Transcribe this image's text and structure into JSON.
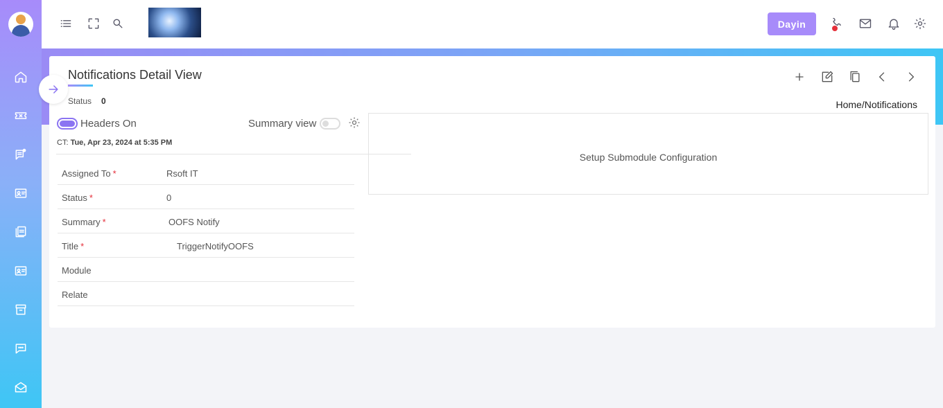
{
  "sidebar": {
    "items": [
      {
        "name": "home"
      },
      {
        "name": "ticket"
      },
      {
        "name": "notes"
      },
      {
        "name": "contact-card"
      },
      {
        "name": "pdf-docs"
      },
      {
        "name": "id-card"
      },
      {
        "name": "archive"
      },
      {
        "name": "chat"
      },
      {
        "name": "mail-open"
      }
    ]
  },
  "header": {
    "user_button": "Dayin",
    "icons": [
      "menu-icon",
      "fullscreen-icon",
      "search-icon",
      "phone-icon",
      "mail-icon",
      "bell-icon",
      "gear-icon"
    ],
    "status_dot_color": "#e5303b"
  },
  "page": {
    "title": "Notifications Detail View",
    "status_label": "Status",
    "status_value": "0",
    "breadcrumb": "Home/Notifications",
    "toolbar_icons": [
      "add-icon",
      "edit-icon",
      "copy-icon",
      "chevron-left-icon",
      "chevron-right-icon"
    ]
  },
  "panel": {
    "headers_toggle_label": "Headers On",
    "headers_toggle_on": true,
    "summary_toggle_label": "Summary view",
    "summary_toggle_on": false,
    "ct_prefix": "CT: ",
    "ct_value": "Tue, Apr 23, 2024 at 5:35 PM",
    "fields": [
      {
        "label": "Assigned To",
        "required": true,
        "value": "Rsoft IT"
      },
      {
        "label": "Status",
        "required": true,
        "value": "0"
      },
      {
        "label": "Summary",
        "required": true,
        "value": "OOFS Notify"
      },
      {
        "label": "Title",
        "required": true,
        "value": "TriggerNotifyOOFS"
      },
      {
        "label": "Module",
        "required": false,
        "value": ""
      },
      {
        "label": "Relate",
        "required": false,
        "value": ""
      }
    ],
    "required_marker": "*"
  },
  "submodule": {
    "text": "Setup Submodule Configuration"
  },
  "colors": {
    "accent": "#a78bfa",
    "accent_dark": "#8b74f2",
    "cyan": "#3ec6f5"
  }
}
